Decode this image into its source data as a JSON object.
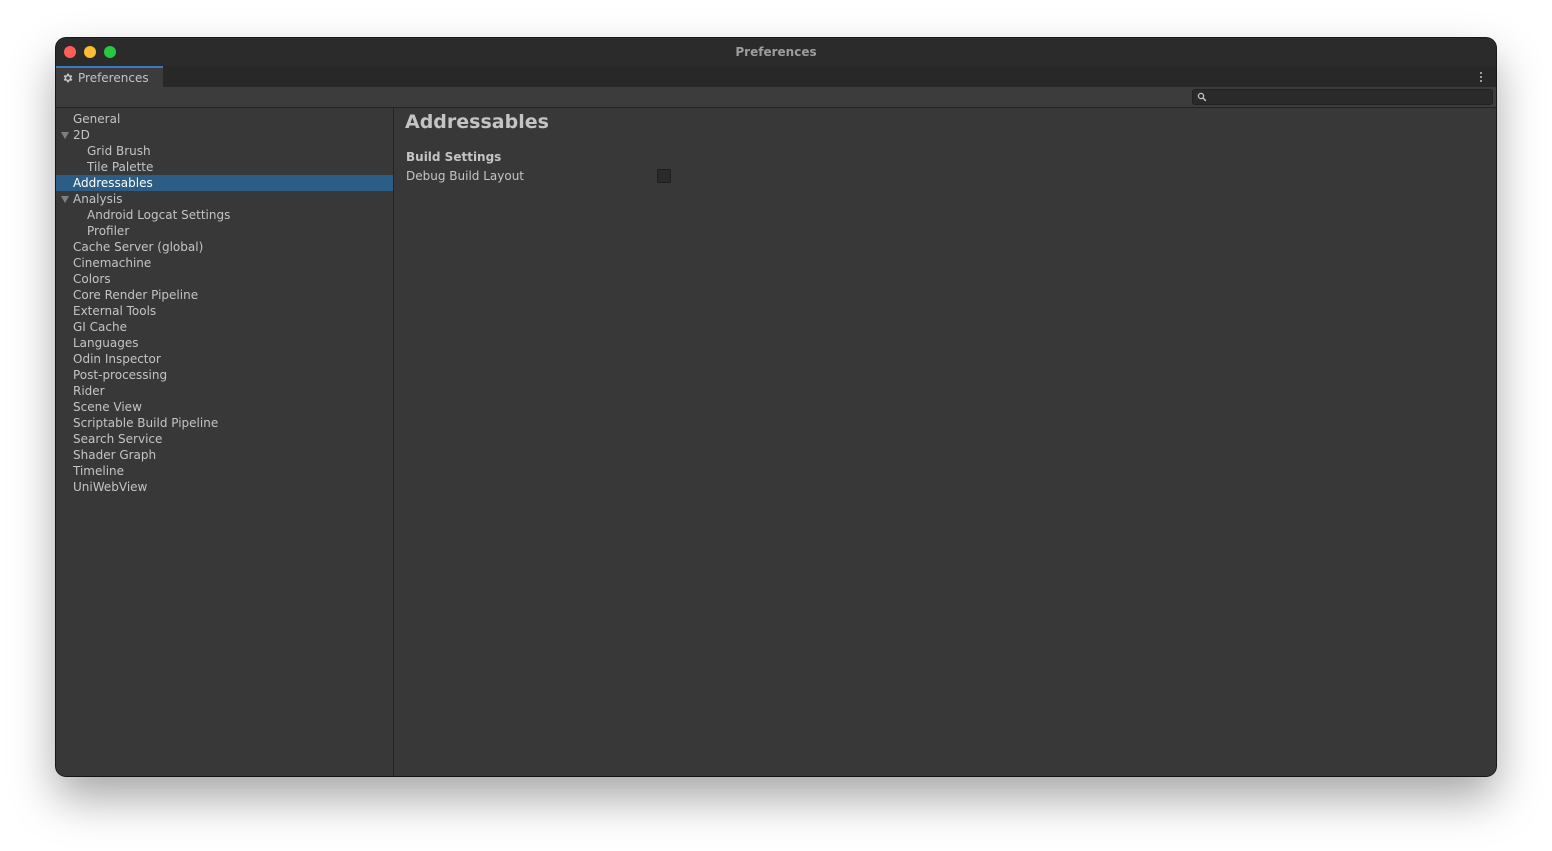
{
  "window": {
    "title": "Preferences"
  },
  "tab": {
    "label": "Preferences",
    "icon": "gear-icon"
  },
  "search": {
    "value": "",
    "placeholder": "",
    "icon": "search-icon"
  },
  "sidebar": {
    "items": [
      {
        "label": "General",
        "level": 0
      },
      {
        "label": "2D",
        "level": 0,
        "expanded": true
      },
      {
        "label": "Grid Brush",
        "level": 1
      },
      {
        "label": "Tile Palette",
        "level": 1
      },
      {
        "label": "Addressables",
        "level": 0,
        "selected": true
      },
      {
        "label": "Analysis",
        "level": 0,
        "expanded": true
      },
      {
        "label": "Android Logcat Settings",
        "level": 1
      },
      {
        "label": "Profiler",
        "level": 1
      },
      {
        "label": "Cache Server (global)",
        "level": 0
      },
      {
        "label": "Cinemachine",
        "level": 0
      },
      {
        "label": "Colors",
        "level": 0
      },
      {
        "label": "Core Render Pipeline",
        "level": 0
      },
      {
        "label": "External Tools",
        "level": 0
      },
      {
        "label": "GI Cache",
        "level": 0
      },
      {
        "label": "Languages",
        "level": 0
      },
      {
        "label": "Odin Inspector",
        "level": 0
      },
      {
        "label": "Post-processing",
        "level": 0
      },
      {
        "label": "Rider",
        "level": 0
      },
      {
        "label": "Scene View",
        "level": 0
      },
      {
        "label": "Scriptable Build Pipeline",
        "level": 0
      },
      {
        "label": "Search Service",
        "level": 0
      },
      {
        "label": "Shader Graph",
        "level": 0
      },
      {
        "label": "Timeline",
        "level": 0
      },
      {
        "label": "UniWebView",
        "level": 0
      }
    ]
  },
  "content": {
    "title": "Addressables",
    "section": "Build Settings",
    "settings": [
      {
        "label": "Debug Build Layout",
        "checked": false
      }
    ]
  },
  "colors": {
    "selection": "#2c5d87",
    "tab_accent": "#3a79bb",
    "window_bg": "#383838",
    "close": "#ff5f57",
    "minimize": "#febc2e",
    "maximize": "#28c840"
  }
}
